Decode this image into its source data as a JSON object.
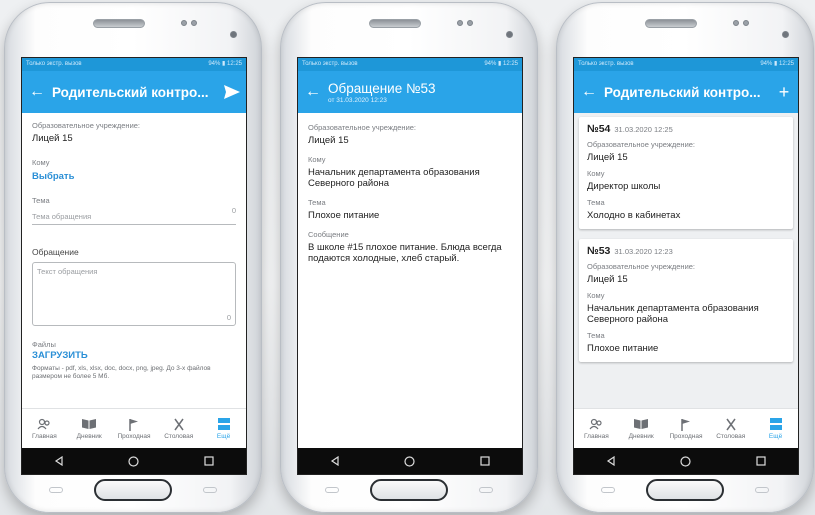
{
  "status": {
    "left": "Только экстр. вызов",
    "right_a": "94%",
    "time_a": "12:25",
    "right_b": "94%",
    "time_b": "12:25",
    "right_c": "94%",
    "time_c": "12:25"
  },
  "screen1": {
    "title": "Родительский контро...",
    "institution_label": "Образовательное учреждение:",
    "institution_value": "Лицей 15",
    "to_label": "Кому",
    "to_action": "Выбрать",
    "topic_label": "Тема",
    "topic_placeholder": "Тема обращения",
    "topic_counter": "0",
    "message_label": "Обращение",
    "message_placeholder": "Текст обращения",
    "message_counter": "0",
    "files_label": "Файлы",
    "upload_action": "ЗАГРУЗИТЬ",
    "files_hint": "Форматы - pdf, xls, xlsx, doc, docx, png, jpeg. До 3-х файлов размером не более 5 Мб."
  },
  "screen2": {
    "title": "Обращение №53",
    "subtitle": "от 31.03.2020 12:23",
    "institution_label": "Образовательное учреждение:",
    "institution_value": "Лицей 15",
    "to_label": "Кому",
    "to_value": "Начальник департамента образования Северного района",
    "topic_label": "Тема",
    "topic_value": "Плохое питание",
    "message_label": "Сообщение",
    "message_value": "В школе #15 плохое питание. Блюда всегда подаются холодные, хлеб старый."
  },
  "screen3": {
    "title": "Родительский контро...",
    "cards": [
      {
        "number": "№54",
        "date": "31.03.2020 12:25",
        "institution_label": "Образовательное учреждение:",
        "institution_value": "Лицей 15",
        "to_label": "Кому",
        "to_value": "Директор школы",
        "topic_label": "Тема",
        "topic_value": "Холодно в кабинетах"
      },
      {
        "number": "№53",
        "date": "31.03.2020 12:23",
        "institution_label": "Образовательное учреждение:",
        "institution_value": "Лицей 15",
        "to_label": "Кому",
        "to_value": "Начальник департамента образования Северного района",
        "topic_label": "Тема",
        "topic_value": "Плохое питание"
      }
    ]
  },
  "nav": {
    "home": "Главная",
    "diary": "Дневник",
    "entrance": "Проходная",
    "canteen": "Столовая",
    "more": "Ещё"
  },
  "colors": {
    "accent": "#2aa4e8",
    "status_bar": "#1e97d8",
    "link": "#2a8fd6"
  }
}
